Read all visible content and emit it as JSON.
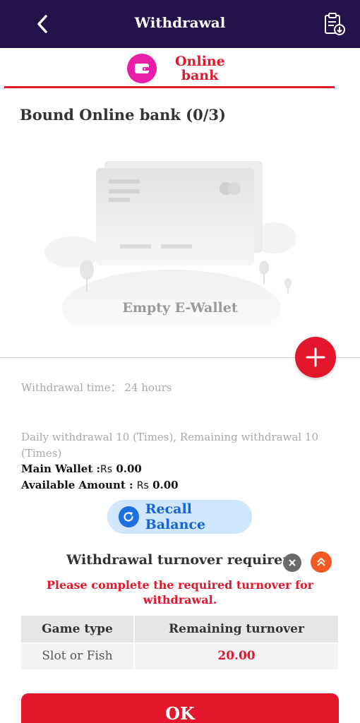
{
  "header": {
    "title": "Withdrawal"
  },
  "tabs": [
    {
      "label_line1": "Online",
      "label_line2": "bank",
      "active": true
    }
  ],
  "bound_section": {
    "title": "Bound Online bank (0/3)",
    "empty_text": "Empty E-Wallet"
  },
  "withdrawal_info": {
    "time_label": "Withdrawal time：",
    "time_value": "24 hours",
    "daily_text": "Daily withdrawal 10 (Times), Remaining withdrawal 10 (Times)",
    "main_wallet_label": "Main Wallet :",
    "main_wallet_currency": "Rs",
    "main_wallet_value": "0.00",
    "available_label": "Available Amount :",
    "available_currency": "Rs",
    "available_value": "0.00"
  },
  "recall_button": {
    "label": "Recall Balance"
  },
  "turnover": {
    "title": "Withdrawal turnover requirement",
    "warning": "Please complete the required turnover for withdrawal.",
    "columns": [
      "Game type",
      "Remaining turnover"
    ],
    "rows": [
      {
        "game_type": "Slot or Fish",
        "remaining": "20.00"
      }
    ]
  },
  "ok_button": {
    "label": "OK"
  },
  "colors": {
    "header_bg": "#24124a",
    "accent_red": "#e3162b",
    "tab_icon_bg": "#e91ea8",
    "recall_bg": "#cfe6fb",
    "recall_text": "#1664d9"
  },
  "icons": {
    "back": "chevron-left-icon",
    "history": "clipboard-download-icon",
    "tab": "wallet-icon",
    "add": "plus-icon",
    "recall": "refresh-icon",
    "close": "close-icon",
    "collapse": "chevron-double-up-icon"
  }
}
